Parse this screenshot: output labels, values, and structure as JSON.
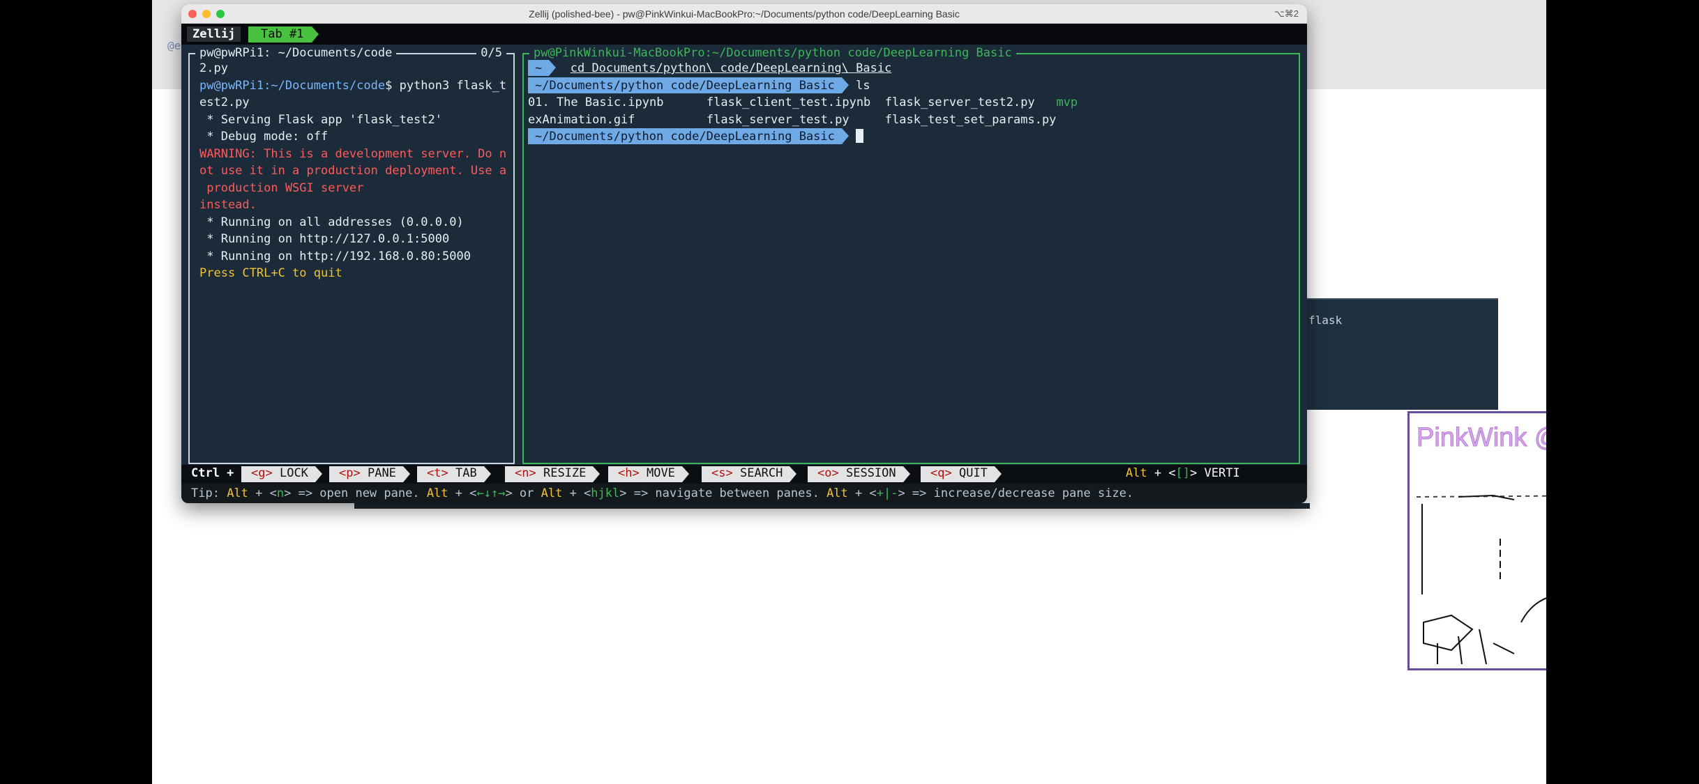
{
  "background": {
    "partial_text": "@e"
  },
  "window": {
    "title": "Zellij (polished-bee) - pw@PinkWinkui-MacBookPro:~/Documents/python code/DeepLearning Basic",
    "shortcut": "⌥⌘2",
    "traffic_lights": {
      "close": "#ff5f57",
      "minimize": "#febc2e",
      "maximize": "#28c840"
    }
  },
  "tabbar": {
    "app_name": "Zellij",
    "tabs": [
      {
        "label": "Tab #1",
        "active": true
      }
    ]
  },
  "left_pane": {
    "title": "pw@pwRPi1: ~/Documents/code",
    "count": "0/5",
    "lines": {
      "l1": "2.py",
      "l2_user": "pw@pwRPi1",
      "l2_path": ":~/Documents/code",
      "l2_cmd": "$ python3 flask_t",
      "l3": "est2.py",
      "l4": " * Serving Flask app 'flask_test2'",
      "l5": " * Debug mode: off",
      "l6": "WARNING: This is a development server. Do n",
      "l7": "ot use it in a production deployment. Use a",
      "l8": " production WSGI server",
      "l9": "instead.",
      "l10": " * Running on all addresses (0.0.0.0)",
      "l11": " * Running on http://127.0.0.1:5000",
      "l12": " * Running on http://192.168.0.80:5000",
      "l13": "Press CTRL+C to quit"
    }
  },
  "right_pane": {
    "title": "pw@PinkWinkui-MacBookPro:~/Documents/python code/DeepLearning Basic",
    "prompt1_path": "~",
    "prompt1_cmd": "cd Documents/python\\ code/DeepLearning\\ Basic",
    "prompt2_path": "~/Documents/python code/DeepLearning Basic",
    "prompt2_cmd": "ls",
    "files": {
      "f1": "01. The Basic.ipynb",
      "f2": "flask_client_test.ipynb",
      "f3": "flask_server_test2.py",
      "f4": "mvp",
      "f5": "exAnimation.gif",
      "f6": "flask_server_test.py",
      "f7": "flask_test_set_params.py"
    },
    "prompt3_path": "~/Documents/python code/DeepLearning Basic"
  },
  "statusbar": {
    "ctrl_label": "Ctrl +",
    "items": [
      {
        "key": "<g>",
        "label": "LOCK"
      },
      {
        "key": "<p>",
        "label": "PANE"
      },
      {
        "key": "<t>",
        "label": "TAB"
      },
      {
        "key": "<n>",
        "label": "RESIZE"
      },
      {
        "key": "<h>",
        "label": "MOVE"
      },
      {
        "key": "<s>",
        "label": "SEARCH"
      },
      {
        "key": "<o>",
        "label": "SESSION"
      },
      {
        "key": "<q>",
        "label": "QUIT"
      }
    ],
    "alt_label": "Alt",
    "alt_mid": " + <",
    "alt_key": "[]",
    "alt_end": ">",
    "vert_label": "VERTI"
  },
  "tip": {
    "prefix": "Tip: ",
    "alt": "Alt",
    "t1": " + <",
    "k1": "n",
    "t2": "> => open new pane. ",
    "t3": " + <",
    "k2": "←↓↑→",
    "t4": "> or ",
    "t5": " + <",
    "k3": "hjkl",
    "t6": "> => navigate between panes. ",
    "t7": " + <",
    "k4": "+|-",
    "t8": "> => increase/decrease pane size."
  },
  "background_window": {
    "text": "flask"
  },
  "webcam": {
    "overlay_text": "PinkWink @  PinkLAB"
  },
  "colors": {
    "pane_bg": "#1b2b39",
    "active_pane_border": "#3db75a",
    "tab_active": "#48c13f",
    "prompt_path_bg": "#6fa9e6",
    "warning": "#ff5a5a",
    "highlight_yellow": "#f1c232"
  }
}
